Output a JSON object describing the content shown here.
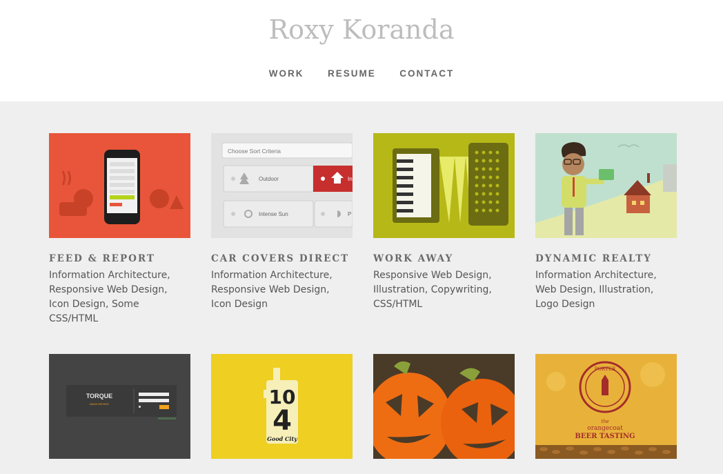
{
  "site": {
    "title": "Roxy Koranda"
  },
  "nav": [
    {
      "label": "WORK"
    },
    {
      "label": "RESUME"
    },
    {
      "label": "CONTACT"
    }
  ],
  "portfolio": [
    {
      "title": "FEED & REPORT",
      "tags": "Information Architecture, Responsive Web Design, Icon Design, Some CSS/HTML",
      "thumb_color": "#e8553a"
    },
    {
      "title": "CAR COVERS DIRECT",
      "tags": "Information Architecture, Responsive Web Design, Icon Design",
      "thumb_color": "#dcdcdc"
    },
    {
      "title": "WORK AWAY",
      "tags": "Responsive Web Design, Illustration, Copywriting, CSS/HTML",
      "thumb_color": "#b6b818"
    },
    {
      "title": "DYNAMIC REALTY",
      "tags": "Information Architecture, Web Design, Illustration, Logo Design",
      "thumb_color": "#bfe0cf"
    },
    {
      "title": "",
      "tags": "",
      "thumb_color": "#444444",
      "thumb_text": "TORQUE",
      "thumb_subtext": "IMAGE ARCHIVE"
    },
    {
      "title": "",
      "tags": "",
      "thumb_color": "#eecf22",
      "thumb_text_top": "10",
      "thumb_text_bottom": "4",
      "thumb_subtext": "Good City"
    },
    {
      "title": "",
      "tags": "",
      "thumb_color": "#ef6d12"
    },
    {
      "title": "",
      "tags": "",
      "thumb_color": "#e8b23a",
      "thumb_seal": "PORTER",
      "thumb_text_line1": "the",
      "thumb_text_line2": "orangecoat",
      "thumb_text_line3": "BEER TASTING"
    }
  ],
  "mock_ui": {
    "sort_placeholder": "Choose Sort Criteria",
    "option_outdoor": "Outdoor",
    "option_sun": "Intense Sun",
    "option_in": "In",
    "option_p": "P"
  }
}
